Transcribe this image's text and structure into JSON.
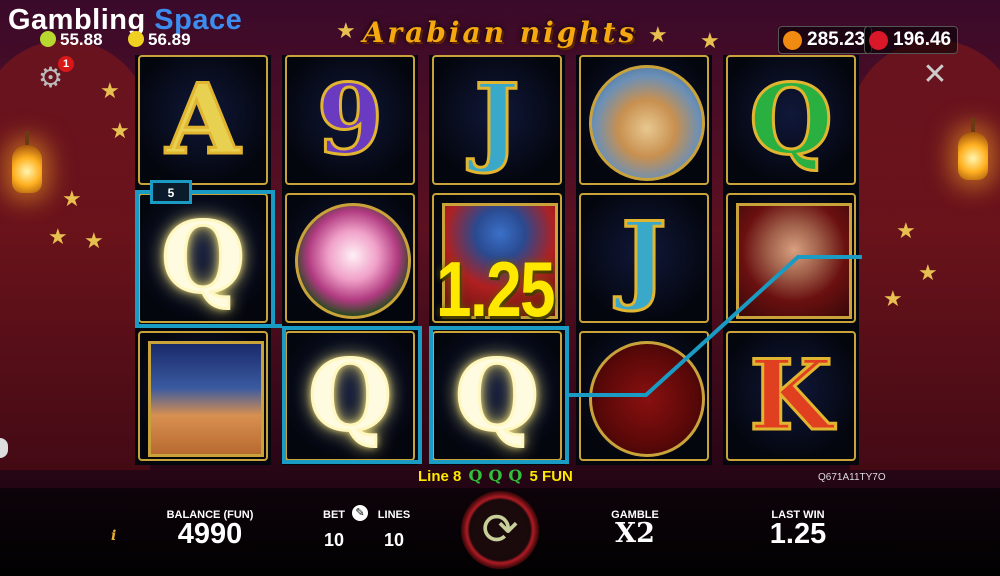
{
  "brand": {
    "logo_part1": "Gambling",
    "logo_part2": "Space"
  },
  "top_left_balances": [
    {
      "icon": "lime-coin-icon",
      "color": "#b8d830",
      "value": "55.88"
    },
    {
      "icon": "yellow-coin-icon",
      "color": "#f0d020",
      "value": "56.89"
    }
  ],
  "game_title": "Arabian nights",
  "top_right_balances": [
    {
      "icon": "orange-fruit-icon",
      "color": "#f08a10",
      "value": "285.23"
    },
    {
      "icon": "strawberry-icon",
      "color": "#d81828",
      "value": "196.46"
    }
  ],
  "settings": {
    "notification_count": "1"
  },
  "reels": [
    [
      "A",
      "Q",
      "camel"
    ],
    [
      "9",
      "lotus",
      "Q"
    ],
    [
      "J",
      "sultan",
      "Q"
    ],
    [
      "teapot",
      "J",
      "swords"
    ],
    [
      "Q",
      "princess",
      "K"
    ]
  ],
  "win": {
    "line_badge": "5",
    "big_amount": "1.25",
    "line_label": "Line 8",
    "line_symbol": "Q",
    "line_payout": "5 FUN"
  },
  "ticket_code": "Q671A11TY7O",
  "bottom_bar": {
    "info_label": "i",
    "balance_label": "BALANCE (FUN)",
    "balance_value": "4990",
    "bet_label": "BET",
    "bet_value": "10",
    "lines_label": "LINES",
    "lines_value": "10",
    "gamble_label": "GAMBLE",
    "gamble_value": "X2",
    "last_win_label": "LAST WIN",
    "last_win_value": "1.25"
  },
  "colors": {
    "win_highlight": "#1a9bc4",
    "reel_frame": "#c9a33a",
    "win_text": "#ffe800"
  }
}
